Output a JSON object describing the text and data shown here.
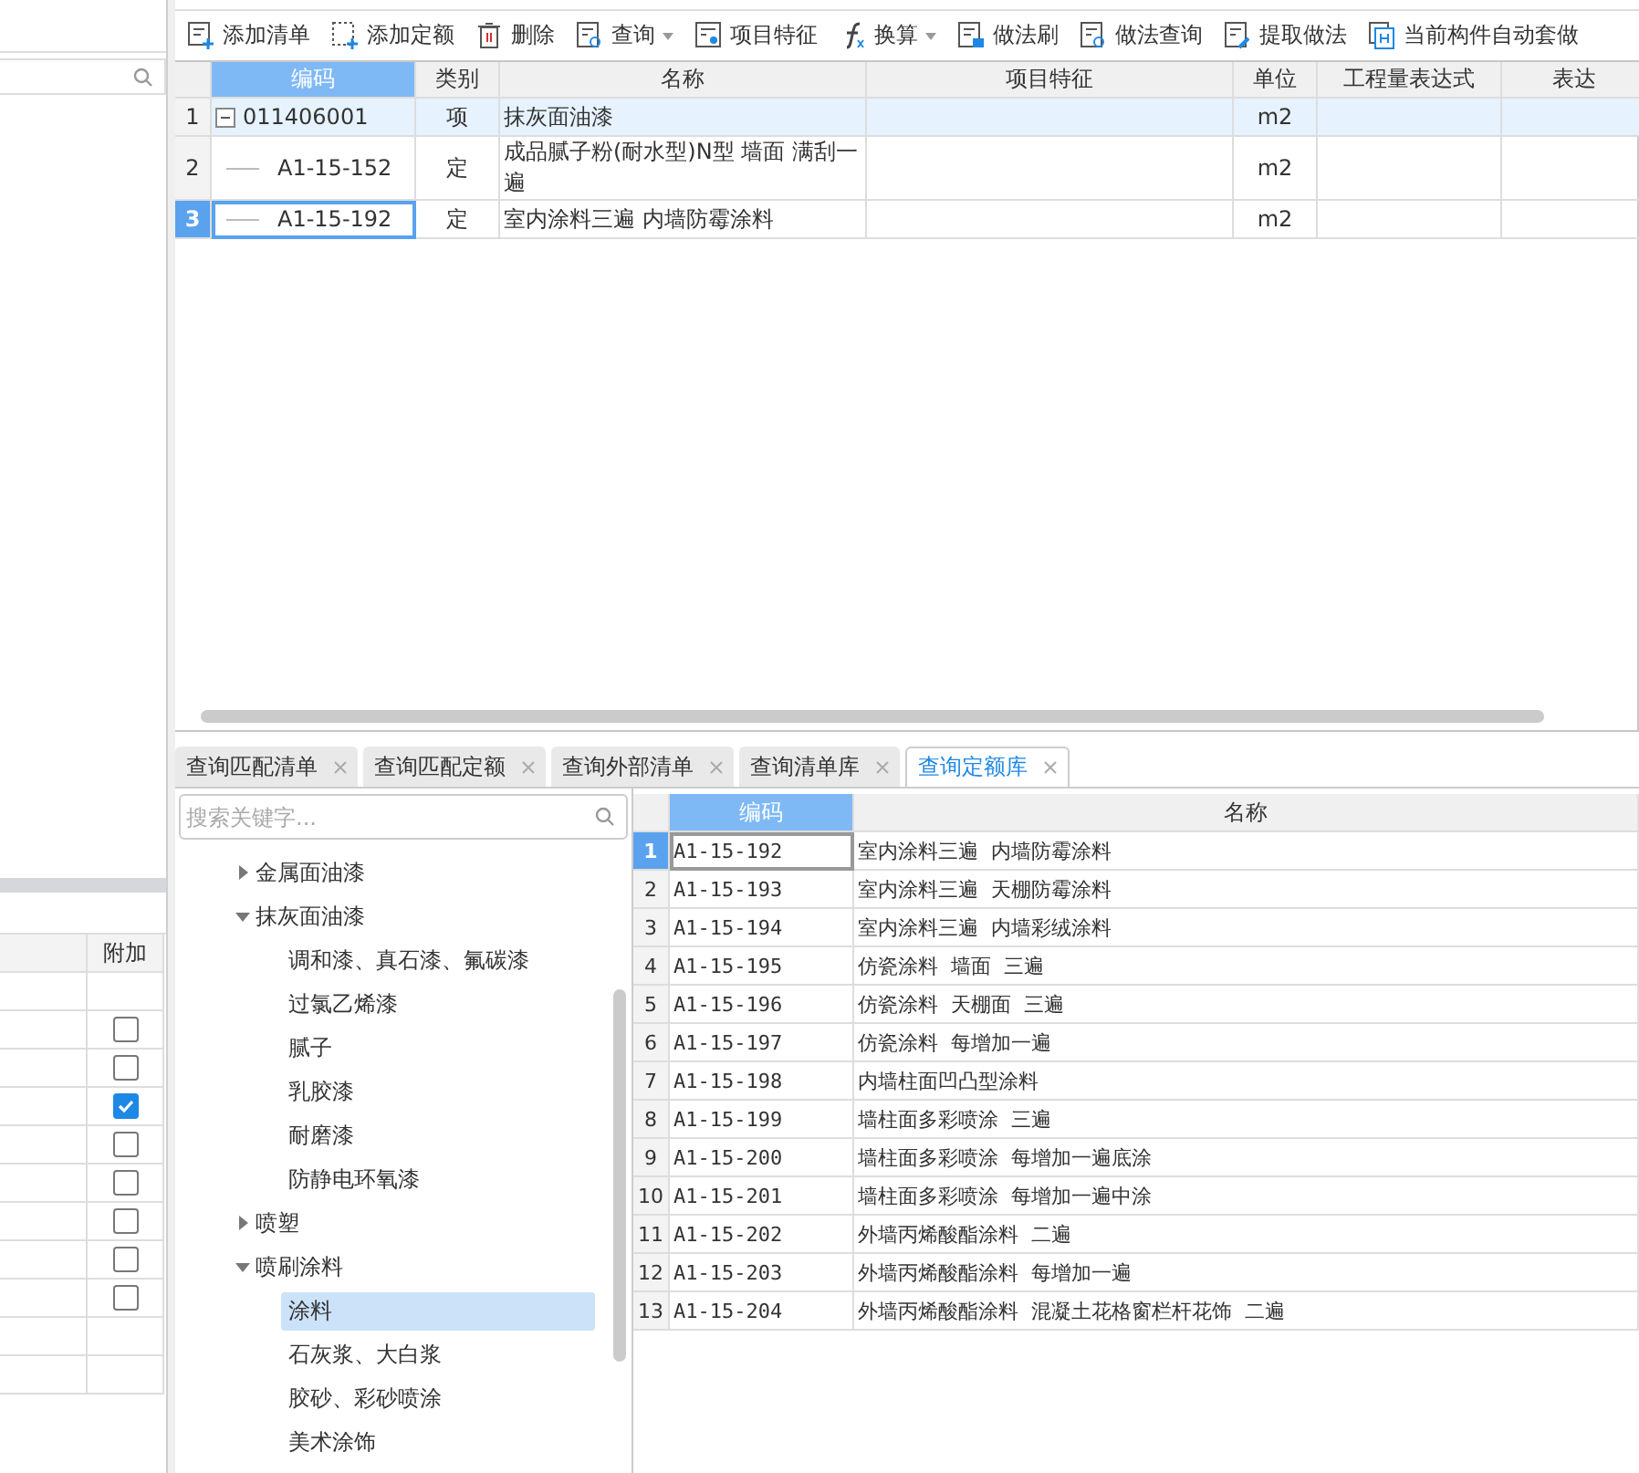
{
  "left_panel": {
    "table": {
      "columns": [
        "附加"
      ],
      "rows": [
        {
          "kind": "blank"
        },
        {
          "kind": "checkbox",
          "checked": false
        },
        {
          "kind": "checkbox",
          "checked": false
        },
        {
          "kind": "checkbox",
          "checked": true
        },
        {
          "kind": "checkbox",
          "checked": false
        },
        {
          "kind": "checkbox",
          "checked": false
        },
        {
          "kind": "checkbox",
          "checked": false
        },
        {
          "kind": "checkbox",
          "checked": false
        },
        {
          "kind": "checkbox",
          "checked": false
        },
        {
          "kind": "blank"
        },
        {
          "kind": "blank"
        }
      ]
    }
  },
  "toolbar": [
    {
      "label": "添加清单",
      "kind": "add-list",
      "dropdown": false
    },
    {
      "label": "添加定额",
      "kind": "add-quota",
      "dropdown": false
    },
    {
      "label": "删除",
      "kind": "delete",
      "dropdown": false
    },
    {
      "label": "查询",
      "kind": "query",
      "dropdown": true
    },
    {
      "label": "项目特征",
      "kind": "feature",
      "dropdown": false
    },
    {
      "label": "换算",
      "kind": "fx",
      "dropdown": true
    },
    {
      "label": "做法刷",
      "kind": "brush",
      "dropdown": false
    },
    {
      "label": "做法查询",
      "kind": "query",
      "dropdown": false
    },
    {
      "label": "提取做法",
      "kind": "extract",
      "dropdown": false
    },
    {
      "label": "当前构件自动套做",
      "kind": "auto",
      "dropdown": false
    }
  ],
  "method_table": {
    "columns": [
      "编码",
      "类别",
      "名称",
      "项目特征",
      "单位",
      "工程量表达式",
      "表达"
    ],
    "rows": [
      {
        "number": "1",
        "code": "011406001",
        "kind": "parent",
        "expanded": true,
        "highlighted": true,
        "selected": false,
        "type": "项",
        "name": "抹灰面油漆",
        "unit": "m2"
      },
      {
        "number": "2",
        "code": "A1-15-152",
        "kind": "child",
        "highlighted": false,
        "selected": false,
        "type": "定",
        "name": "成品腻子粉(耐水型)N型 墙面 满刮一遍",
        "unit": "m2"
      },
      {
        "number": "3",
        "code": "A1-15-192",
        "kind": "child",
        "highlighted": false,
        "selected": true,
        "type": "定",
        "name": "室内涂料三遍 内墙防霉涂料",
        "unit": "m2"
      }
    ]
  },
  "bottom_tabs": [
    {
      "label": "查询匹配清单",
      "selected": false
    },
    {
      "label": "查询匹配定额",
      "selected": false
    },
    {
      "label": "查询外部清单",
      "selected": false
    },
    {
      "label": "查询清单库",
      "selected": false
    },
    {
      "label": "查询定额库",
      "selected": true
    }
  ],
  "tree": {
    "search": {
      "placeholder": "搜索关键字..."
    },
    "items": [
      {
        "label": "金属面油漆",
        "expanded": false,
        "selected": false
      },
      {
        "label": "抹灰面油漆",
        "expanded": true,
        "selected": false,
        "children": [
          {
            "label": "调和漆、真石漆、氟碳漆",
            "selected": false
          },
          {
            "label": "过氯乙烯漆",
            "selected": false
          },
          {
            "label": "腻子",
            "selected": false
          },
          {
            "label": "乳胶漆",
            "selected": false
          },
          {
            "label": "耐磨漆",
            "selected": false
          },
          {
            "label": "防静电环氧漆",
            "selected": false
          }
        ]
      },
      {
        "label": "喷塑",
        "expanded": false,
        "selected": false
      },
      {
        "label": "喷刷涂料",
        "expanded": true,
        "selected": false,
        "children": [
          {
            "label": "涂料",
            "selected": true
          },
          {
            "label": "石灰浆、大白浆",
            "selected": false
          },
          {
            "label": "胶砂、彩砂喷涂",
            "selected": false
          },
          {
            "label": "美术涂饰",
            "selected": false
          }
        ]
      }
    ]
  },
  "quota_table": {
    "columns": [
      "编码",
      "名称"
    ],
    "rows": [
      {
        "number": "1",
        "code": "A1-15-192",
        "name": "室内涂料三遍  内墙防霉涂料",
        "selected": true
      },
      {
        "number": "2",
        "code": "A1-15-193",
        "name": "室内涂料三遍  天棚防霉涂料",
        "selected": false
      },
      {
        "number": "3",
        "code": "A1-15-194",
        "name": "室内涂料三遍  内墙彩绒涂料",
        "selected": false
      },
      {
        "number": "4",
        "code": "A1-15-195",
        "name": "仿瓷涂料  墙面  三遍",
        "selected": false
      },
      {
        "number": "5",
        "code": "A1-15-196",
        "name": "仿瓷涂料  天棚面  三遍",
        "selected": false
      },
      {
        "number": "6",
        "code": "A1-15-197",
        "name": "仿瓷涂料  每增加一遍",
        "selected": false
      },
      {
        "number": "7",
        "code": "A1-15-198",
        "name": "内墙柱面凹凸型涂料",
        "selected": false
      },
      {
        "number": "8",
        "code": "A1-15-199",
        "name": "墙柱面多彩喷涂  三遍",
        "selected": false
      },
      {
        "number": "9",
        "code": "A1-15-200",
        "name": "墙柱面多彩喷涂  每增加一遍底涂",
        "selected": false
      },
      {
        "number": "10",
        "code": "A1-15-201",
        "name": "墙柱面多彩喷涂  每增加一遍中涂",
        "selected": false
      },
      {
        "number": "11",
        "code": "A1-15-202",
        "name": "外墙丙烯酸酯涂料  二遍",
        "selected": false
      },
      {
        "number": "12",
        "code": "A1-15-203",
        "name": "外墙丙烯酸酯涂料  每增加一遍",
        "selected": false
      },
      {
        "number": "13",
        "code": "A1-15-204",
        "name": "外墙丙烯酸酯涂料  混凝土花格窗栏杆花饰  二遍",
        "selected": false
      }
    ]
  }
}
